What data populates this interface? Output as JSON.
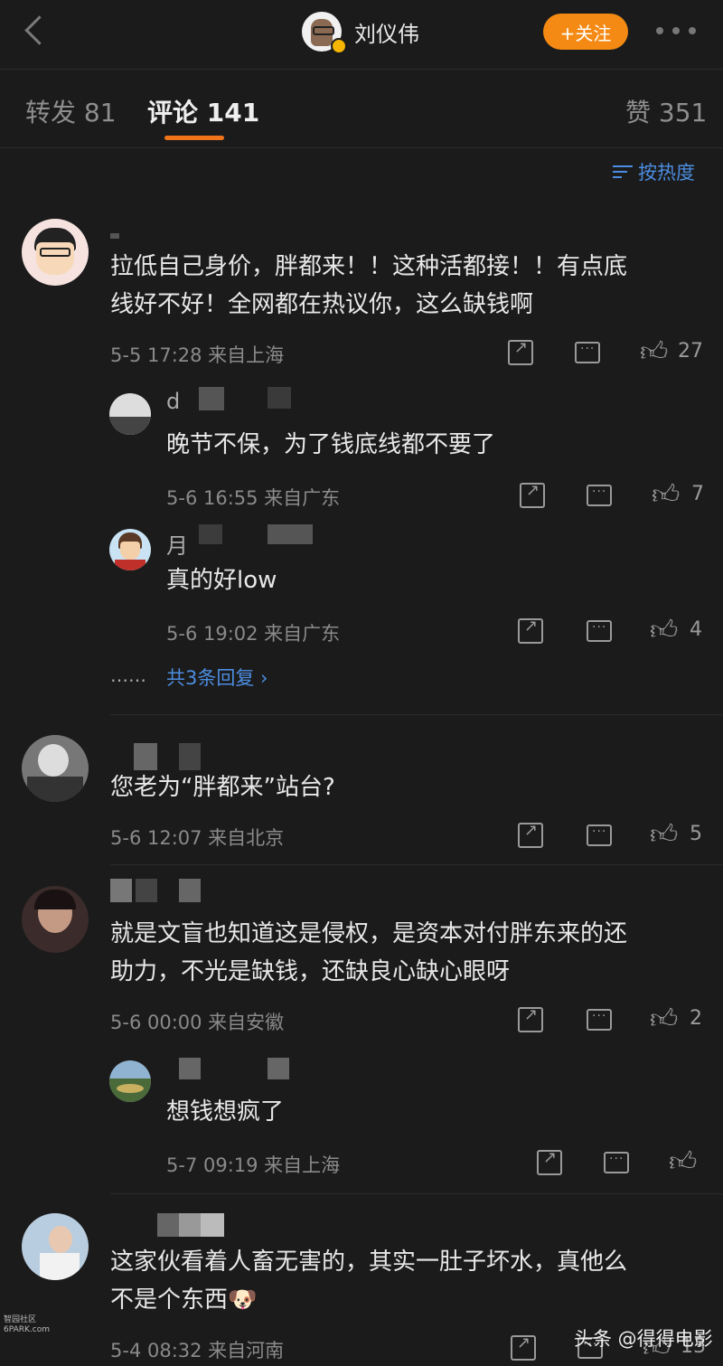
{
  "header": {
    "title": "刘仪伟",
    "follow_label": "+关注"
  },
  "tabs": [
    {
      "label": "转发 81"
    },
    {
      "label": "评论 141"
    },
    {
      "label": "赞 351"
    }
  ],
  "sort_label": "按热度",
  "comments": [
    {
      "text_line1": "拉低自己身价，胖都来！！这种活都接！！有点底",
      "text_line2": "线好不好！全网都在热议你，这么缺钱啊",
      "meta": "5-5 17:28 来自上海",
      "likes": "27",
      "replies": [
        {
          "name_initial": "d",
          "text": "晚节不保，为了钱底线都不要了",
          "meta": "5-6 16:55 来自广东",
          "likes": "7"
        },
        {
          "name_initial": "月",
          "text": "真的好low",
          "meta": "5-6 19:02 来自广东",
          "likes": "4"
        }
      ],
      "more_replies": "共3条回复 ›",
      "more_dots": "……"
    },
    {
      "text": "您老为“胖都来”站台?",
      "meta": "5-6 12:07 来自北京",
      "likes": "5"
    },
    {
      "text_line1": "就是文盲也知道这是侵权，是资本对付胖东来的还",
      "text_line2": "助力，不光是缺钱，还缺良心缺心眼呀",
      "meta": "5-6 00:00 来自安徽",
      "likes": "2",
      "replies": [
        {
          "text": "想钱想疯了",
          "meta": "5-7 09:19 来自上海"
        }
      ]
    },
    {
      "text_line1": "这家伙看着人畜无害的，其实一肚子坏水，真他么",
      "text_line2": "不是个东西🐶",
      "meta": "5-4 08:32 来自河南",
      "likes": "13"
    }
  ],
  "watermark": "头条 @得得电影",
  "logo_watermark": "智园社区 6PARK.com",
  "colors": {
    "background": "#1b1b1b",
    "accent_orange": "#f48a14",
    "link_blue": "#4c8de0"
  }
}
